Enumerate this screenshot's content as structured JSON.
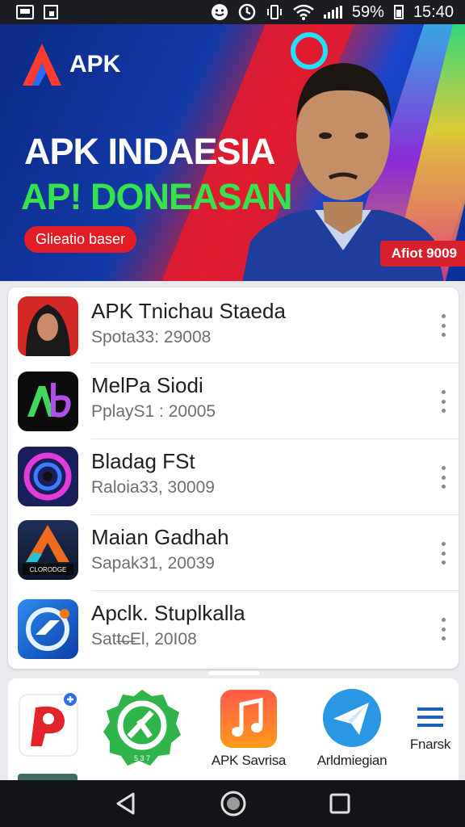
{
  "status_bar": {
    "battery": "59%",
    "time": "15:40",
    "icons": [
      "gallery-icon",
      "photo-icon",
      "face-icon",
      "alarm-icon",
      "vibrate-icon",
      "wifi-icon",
      "signal-icon",
      "battery-icon"
    ]
  },
  "banner": {
    "logo_text": "APK",
    "headline_line1": "APK INDAESIA",
    "headline_line2": "AP! DONEASAN",
    "button_label": "Glieatio baser",
    "badge": "Afiot 9009",
    "colors": {
      "accent_red": "#e31d25",
      "accent_green": "#36e34e",
      "background": "#123aa8"
    }
  },
  "apps_list": {
    "items": [
      {
        "title": "APK Tnichau Staeda",
        "subtitle": "Spota33: 29008"
      },
      {
        "title": "MelPa Siodi",
        "subtitle": "PplayS1 : 20005"
      },
      {
        "title": "Bladag FSt",
        "subtitle": "Raloia33, 30009"
      },
      {
        "title": "Maian Gadhah",
        "subtitle": "Sapak31, 20039"
      },
      {
        "title": "Apclk. Stuplkalla",
        "subtitle": "Satt̶c̶El, 20I08"
      }
    ],
    "icon_captions": {
      "maian": "CLORODGE"
    }
  },
  "dock": {
    "apps": [
      {
        "label": "",
        "icon": "p-app-icon"
      },
      {
        "label": "",
        "icon": "green-badge-icon",
        "icon_text": "5 3 7"
      },
      {
        "label": "APK Savrisa",
        "icon": "music-note-icon"
      },
      {
        "label": "Arldmiegian",
        "icon": "paper-plane-icon"
      },
      {
        "label": "Fnarsk",
        "icon": "menu-icon"
      }
    ]
  },
  "nav_bar": {
    "buttons": [
      "back-icon",
      "home-icon",
      "recents-icon"
    ]
  }
}
